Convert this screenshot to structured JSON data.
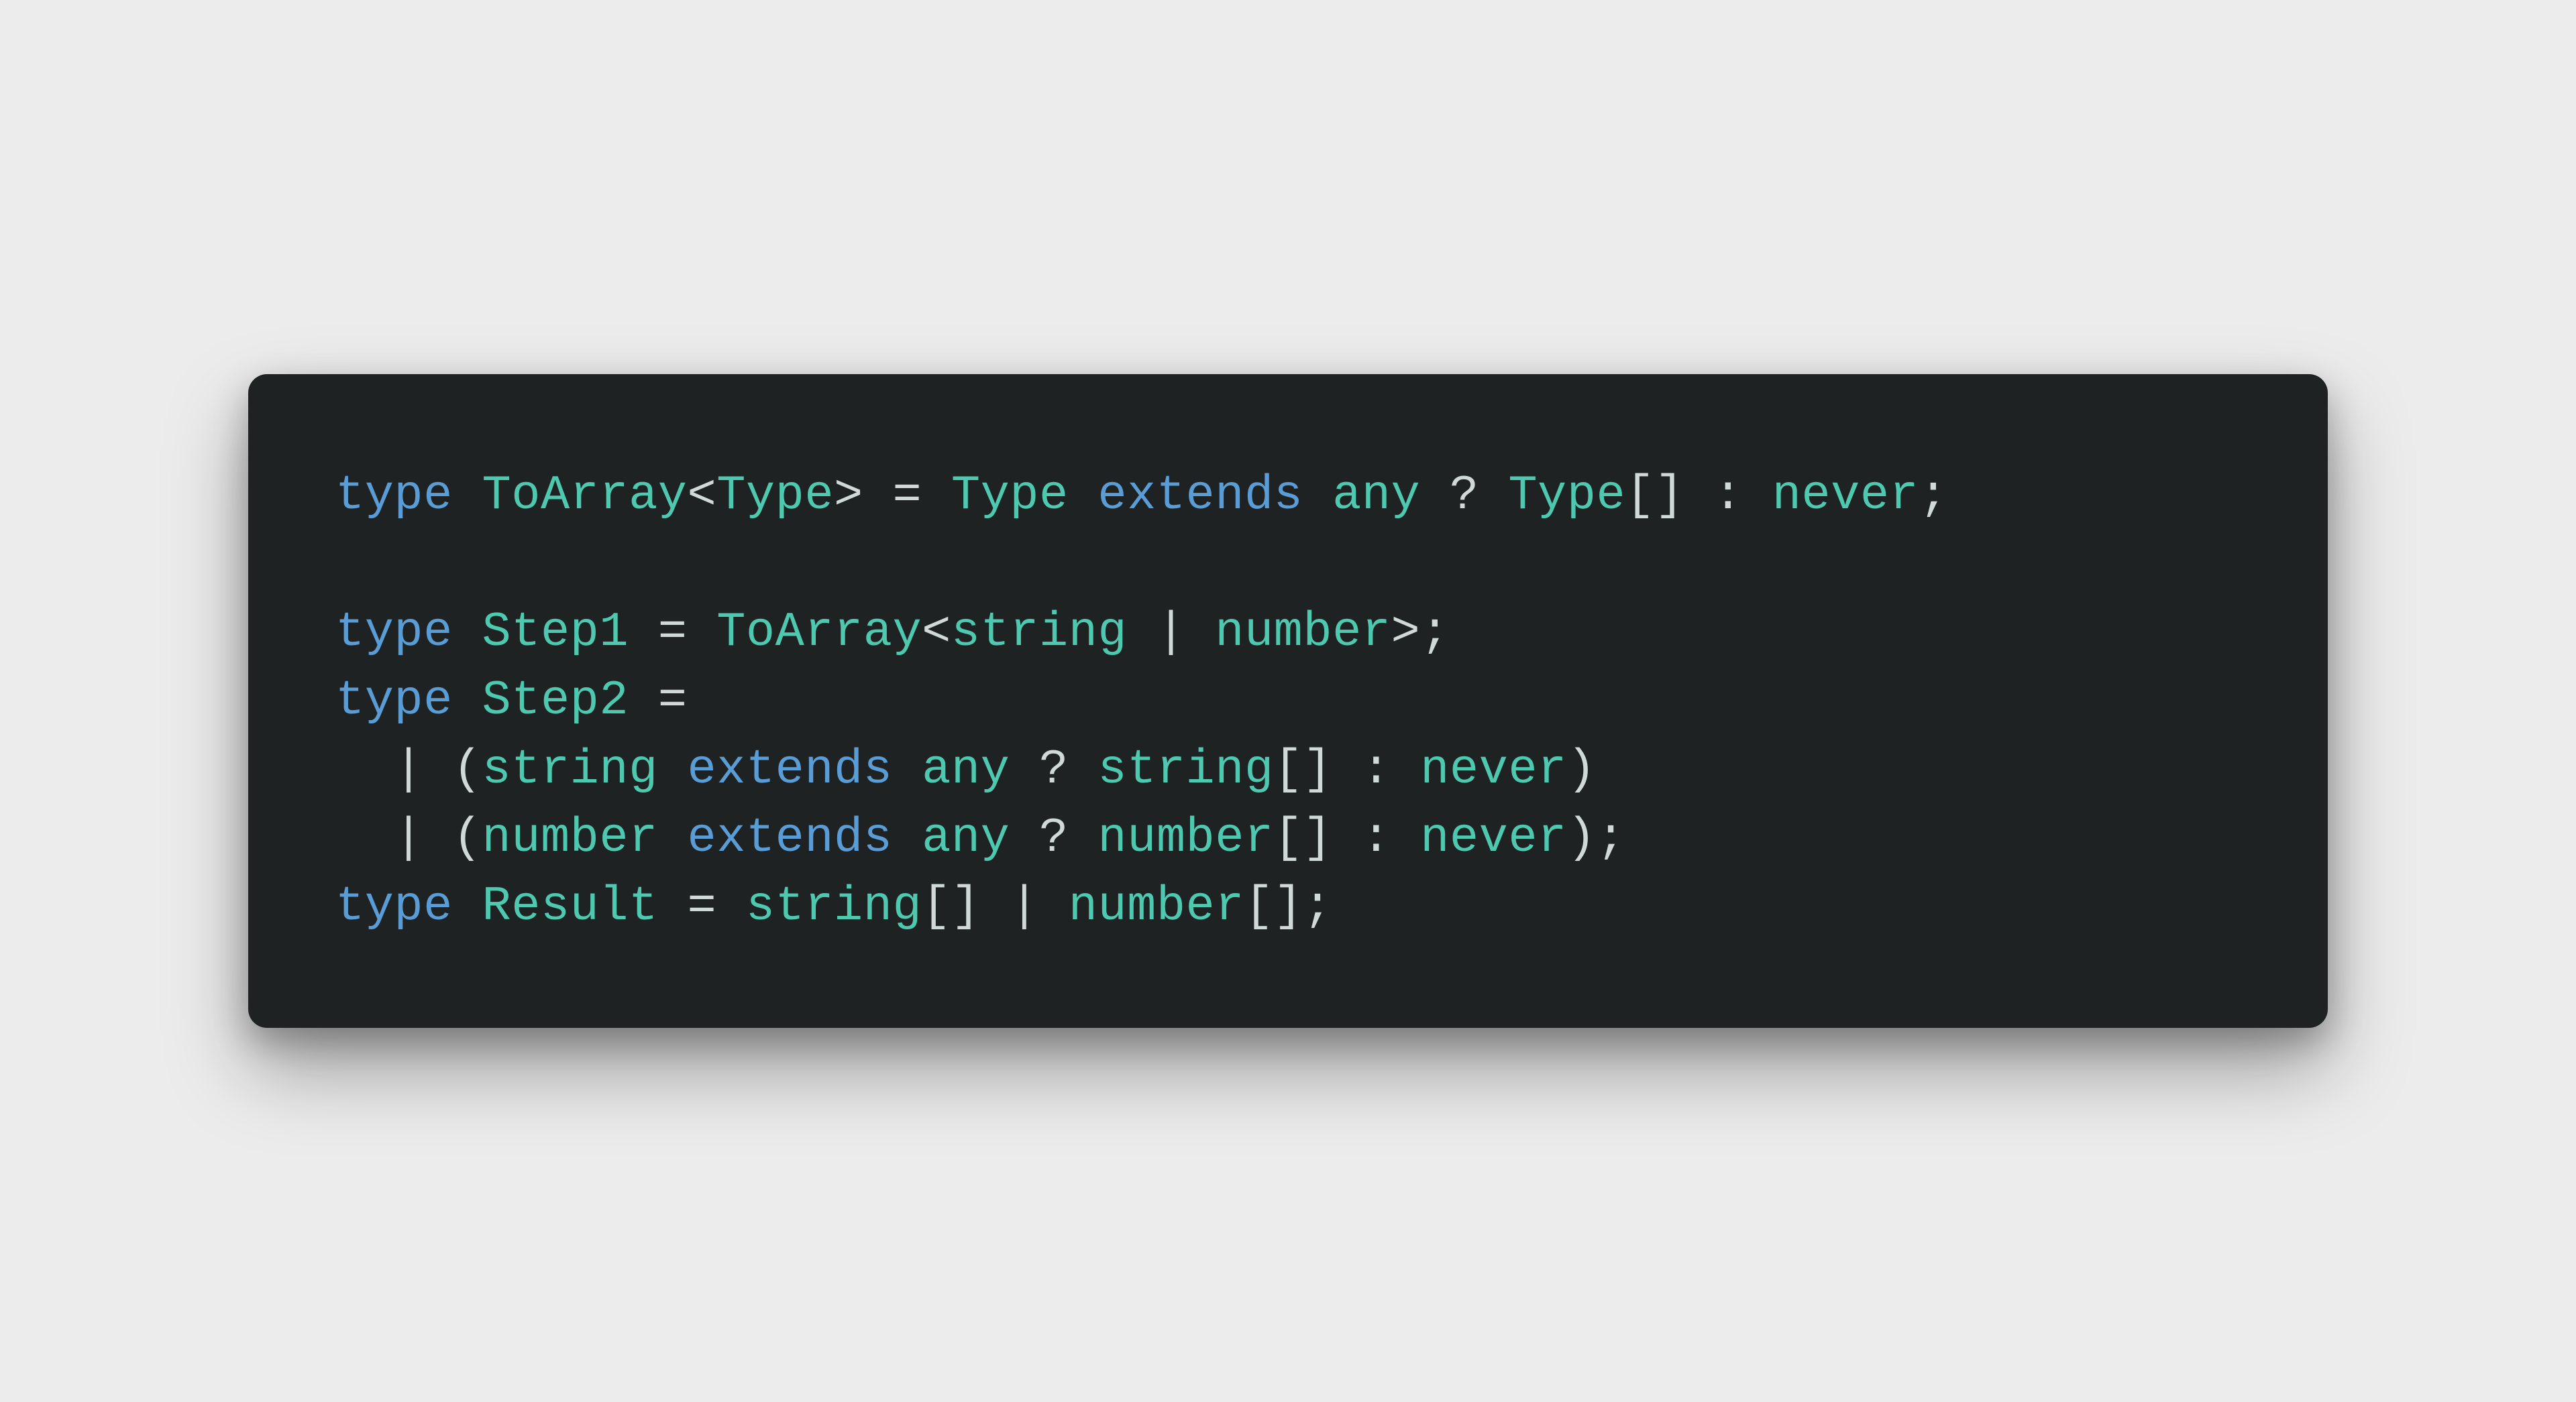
{
  "code": {
    "lines": [
      {
        "tokens": [
          {
            "text": "type ",
            "class": "kw"
          },
          {
            "text": "ToArray",
            "class": "typename"
          },
          {
            "text": "<",
            "class": "punct"
          },
          {
            "text": "Type",
            "class": "typename"
          },
          {
            "text": "> = ",
            "class": "op"
          },
          {
            "text": "Type",
            "class": "typename"
          },
          {
            "text": " extends ",
            "class": "kw"
          },
          {
            "text": "any",
            "class": "builtin"
          },
          {
            "text": " ? ",
            "class": "op"
          },
          {
            "text": "Type",
            "class": "typename"
          },
          {
            "text": "[] : ",
            "class": "punct"
          },
          {
            "text": "never",
            "class": "builtin"
          },
          {
            "text": ";",
            "class": "punct"
          }
        ]
      },
      {
        "tokens": [
          {
            "text": "",
            "class": "punct"
          }
        ]
      },
      {
        "tokens": [
          {
            "text": "type ",
            "class": "kw"
          },
          {
            "text": "Step1",
            "class": "typename"
          },
          {
            "text": " = ",
            "class": "op"
          },
          {
            "text": "ToArray",
            "class": "typename"
          },
          {
            "text": "<",
            "class": "punct"
          },
          {
            "text": "string",
            "class": "builtin"
          },
          {
            "text": " | ",
            "class": "op"
          },
          {
            "text": "number",
            "class": "builtin"
          },
          {
            "text": ">;",
            "class": "punct"
          }
        ]
      },
      {
        "tokens": [
          {
            "text": "type ",
            "class": "kw"
          },
          {
            "text": "Step2",
            "class": "typename"
          },
          {
            "text": " =",
            "class": "op"
          }
        ]
      },
      {
        "tokens": [
          {
            "text": "  | (",
            "class": "punct"
          },
          {
            "text": "string",
            "class": "builtin"
          },
          {
            "text": " extends ",
            "class": "kw"
          },
          {
            "text": "any",
            "class": "builtin"
          },
          {
            "text": " ? ",
            "class": "op"
          },
          {
            "text": "string",
            "class": "builtin"
          },
          {
            "text": "[] : ",
            "class": "punct"
          },
          {
            "text": "never",
            "class": "builtin"
          },
          {
            "text": ")",
            "class": "punct"
          }
        ]
      },
      {
        "tokens": [
          {
            "text": "  | (",
            "class": "punct"
          },
          {
            "text": "number",
            "class": "builtin"
          },
          {
            "text": " extends ",
            "class": "kw"
          },
          {
            "text": "any",
            "class": "builtin"
          },
          {
            "text": " ? ",
            "class": "op"
          },
          {
            "text": "number",
            "class": "builtin"
          },
          {
            "text": "[] : ",
            "class": "punct"
          },
          {
            "text": "never",
            "class": "builtin"
          },
          {
            "text": ");",
            "class": "punct"
          }
        ]
      },
      {
        "tokens": [
          {
            "text": "type ",
            "class": "kw"
          },
          {
            "text": "Result",
            "class": "typename"
          },
          {
            "text": " = ",
            "class": "op"
          },
          {
            "text": "string",
            "class": "builtin"
          },
          {
            "text": "[] | ",
            "class": "punct"
          },
          {
            "text": "number",
            "class": "builtin"
          },
          {
            "text": "[];",
            "class": "punct"
          }
        ]
      }
    ]
  }
}
